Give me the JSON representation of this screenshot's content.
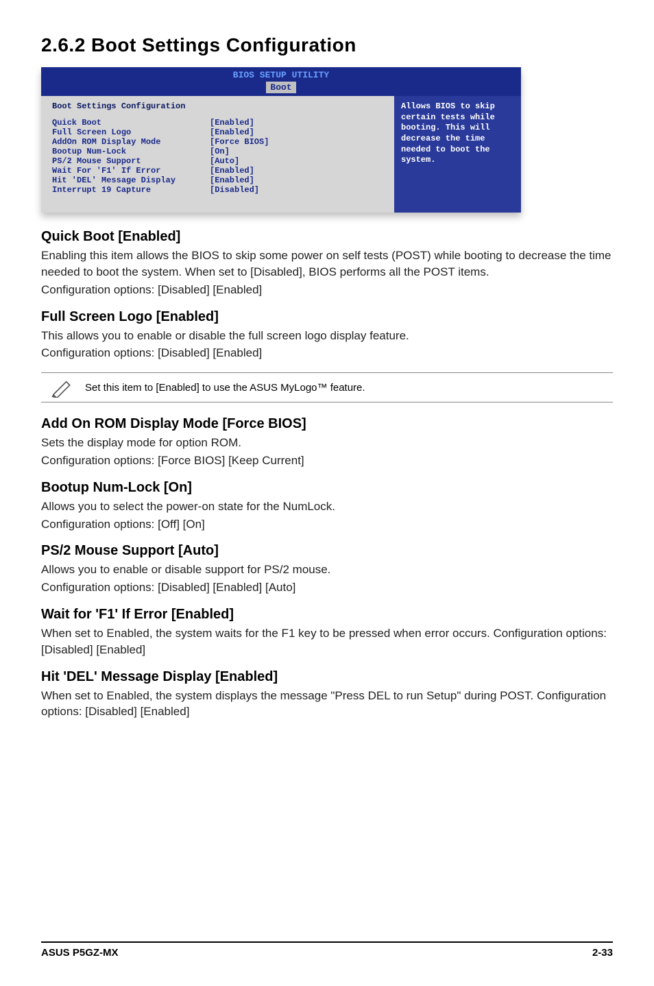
{
  "section_heading": "2.6.2  Boot Settings Configuration",
  "bios": {
    "title": "BIOS SETUP UTILITY",
    "tab": "Boot",
    "panel_heading": "Boot Settings Configuration",
    "settings": [
      {
        "label": "Quick Boot",
        "value": "[Enabled]"
      },
      {
        "label": "Full Screen Logo",
        "value": "[Enabled]"
      },
      {
        "label": "AddOn ROM Display Mode",
        "value": "[Force BIOS]"
      },
      {
        "label": "Bootup Num-Lock",
        "value": "[On]"
      },
      {
        "label": "PS/2 Mouse Support",
        "value": "[Auto]"
      },
      {
        "label": "Wait For 'F1' If Error",
        "value": "[Enabled]"
      },
      {
        "label": "Hit 'DEL' Message Display",
        "value": "[Enabled]"
      },
      {
        "label": "Interrupt 19 Capture",
        "value": "[Disabled]"
      }
    ],
    "help_text": "Allows BIOS to skip certain tests while booting. This will decrease the time needed to boot the system."
  },
  "options": [
    {
      "title": "Quick Boot [Enabled]",
      "body": "Enabling this item allows the BIOS to skip some power on self tests (POST) while booting to decrease the time needed to boot the system. When set to [Disabled], BIOS performs all the POST items.",
      "config": "Configuration options: [Disabled] [Enabled]"
    },
    {
      "title": "Full Screen Logo [Enabled]",
      "body": "This allows you to enable or disable the full screen logo display feature.",
      "config": "Configuration options: [Disabled] [Enabled]"
    }
  ],
  "note": "Set this item to [Enabled] to use the ASUS MyLogo™ feature.",
  "options2": [
    {
      "title": "Add On ROM Display Mode [Force BIOS]",
      "body": "Sets the display mode for option ROM.",
      "config": "Configuration options: [Force BIOS] [Keep Current]"
    },
    {
      "title": "Bootup Num-Lock [On]",
      "body": "Allows you to select the power-on state for the NumLock.",
      "config": "Configuration options: [Off] [On]"
    },
    {
      "title": "PS/2 Mouse Support [Auto]",
      "body": "Allows you to enable or disable support for PS/2 mouse.",
      "config": "Configuration options: [Disabled] [Enabled] [Auto]"
    },
    {
      "title": "Wait for 'F1' If Error [Enabled]",
      "body": "When set to Enabled, the system waits for the F1 key to be pressed when error occurs. Configuration options: [Disabled] [Enabled]",
      "config": ""
    },
    {
      "title": "Hit 'DEL' Message Display [Enabled]",
      "body": "When set to Enabled, the system displays the message \"Press DEL to run Setup\" during POST. Configuration options: [Disabled] [Enabled]",
      "config": ""
    }
  ],
  "footer": {
    "left": "ASUS P5GZ-MX",
    "right": "2-33"
  }
}
